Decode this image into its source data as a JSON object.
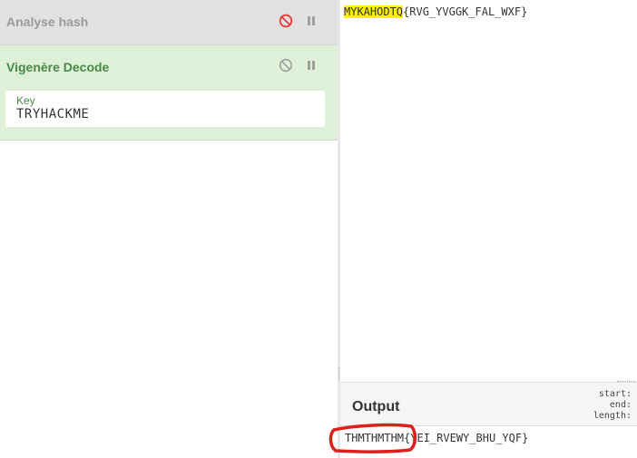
{
  "recipe": {
    "operations": [
      {
        "name": "Analyse hash",
        "state": "disabled"
      },
      {
        "name": "Vigenère Decode",
        "state": "active"
      }
    ],
    "vigenere_key": {
      "label": "Key",
      "value": "TRYHACKME"
    }
  },
  "input": {
    "highlighted": "MYKAHODTQ",
    "rest": "{RVG_YVGGK_FAL_WXF}"
  },
  "output": {
    "title": "Output",
    "stats": {
      "start": "start:",
      "end": "end:",
      "length": "length:"
    },
    "circled": "THMTHMTHM",
    "rest": "{YEI_RVEWY_BHU_YQF}"
  },
  "colors": {
    "active_op_bg": "#dff0d8",
    "active_op_text": "#468847",
    "disabled_op_bg": "#e1e1e1",
    "disable_icon_red": "#e53935",
    "highlight": "#fff200",
    "annotation_red": "#e11d1d"
  },
  "icons": {
    "disable_op": "ban-icon",
    "breakpoint": "pause-icon"
  }
}
